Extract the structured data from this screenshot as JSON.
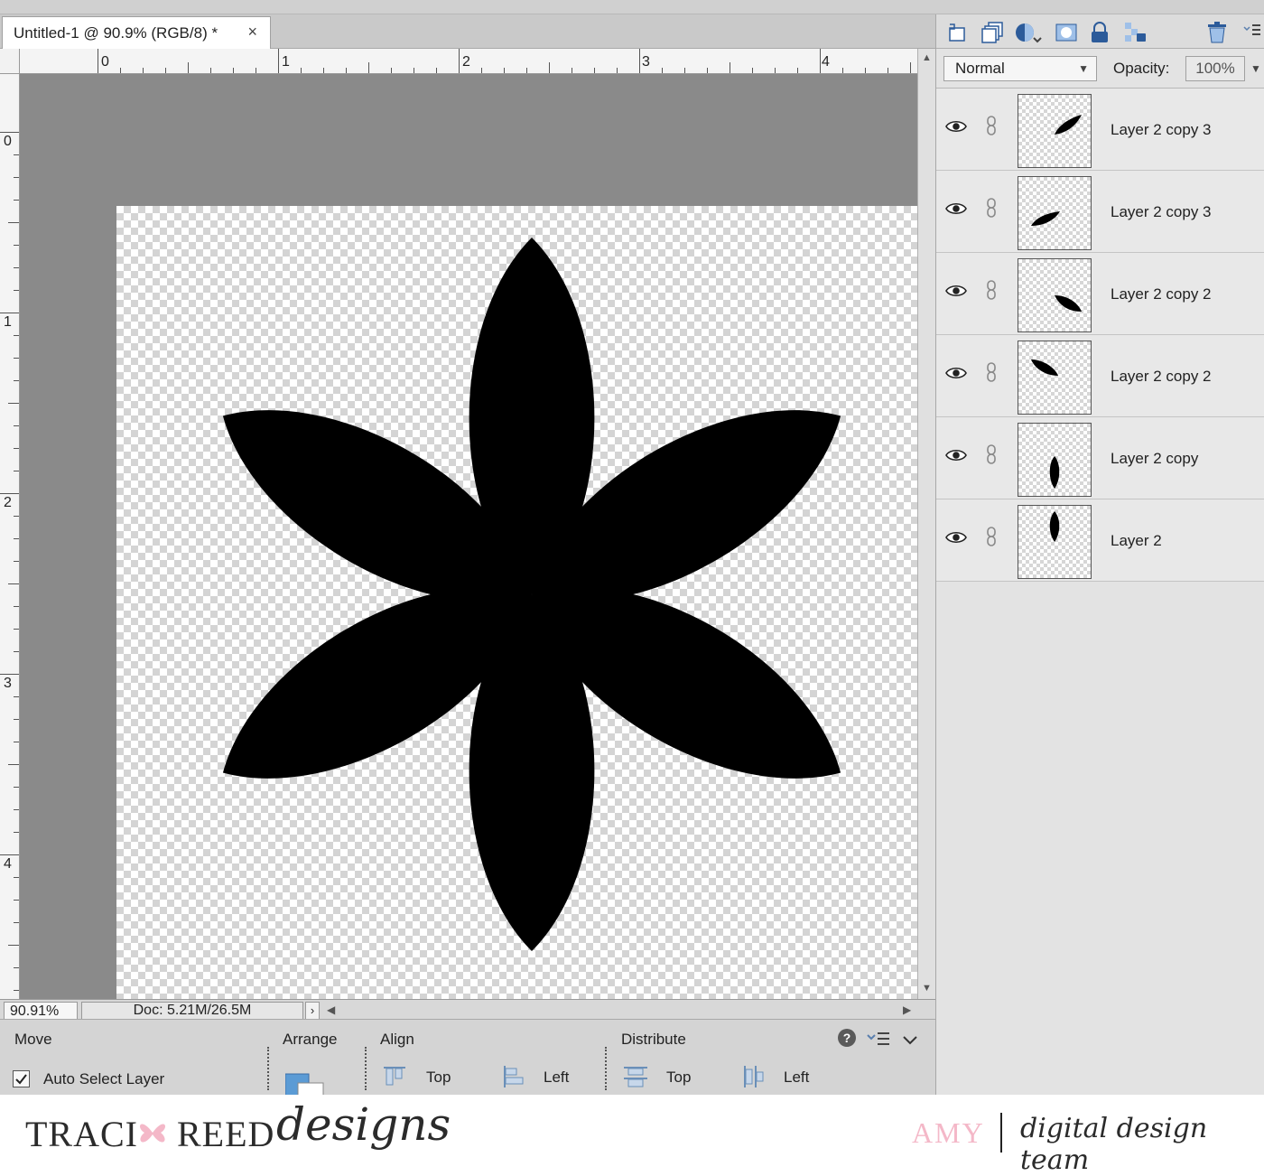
{
  "document": {
    "tab_title": "Untitled-1 @ 90.9% (RGB/8) *",
    "close_glyph": "×",
    "ruler_h_labels": [
      "0",
      "1",
      "2",
      "3",
      "4"
    ],
    "ruler_v_labels": [
      "0",
      "1",
      "2",
      "3",
      "4"
    ],
    "shape": "six-petal-flower",
    "fill_color": "#000000"
  },
  "status": {
    "zoom": "90.91%",
    "doc_info": "Doc: 5.21M/26.5M",
    "arrow": "›"
  },
  "options": {
    "tool_name": "Move",
    "auto_select_label": "Auto Select Layer",
    "auto_select_checked": true,
    "arrange_label": "Arrange",
    "align_label": "Align",
    "align_top": "Top",
    "align_left": "Left",
    "distribute_label": "Distribute",
    "distribute_top": "Top",
    "distribute_left": "Left",
    "help_glyph": "?"
  },
  "layers_panel": {
    "blend_mode": "Normal",
    "opacity_label": "Opacity:",
    "opacity_value": "100%",
    "layers": [
      {
        "name": "Layer 2 copy 3",
        "visible": true
      },
      {
        "name": "Layer 2 copy 3",
        "visible": true
      },
      {
        "name": "Layer 2 copy 2",
        "visible": true
      },
      {
        "name": "Layer 2 copy 2",
        "visible": true
      },
      {
        "name": "Layer 2 copy",
        "visible": true
      },
      {
        "name": "Layer 2",
        "visible": true
      }
    ]
  },
  "branding": {
    "traci": "TRACI",
    "reed": "REED",
    "designs": "designs",
    "name": "AMY",
    "team": "digital design team",
    "accent_color": "#f4b8c8"
  }
}
